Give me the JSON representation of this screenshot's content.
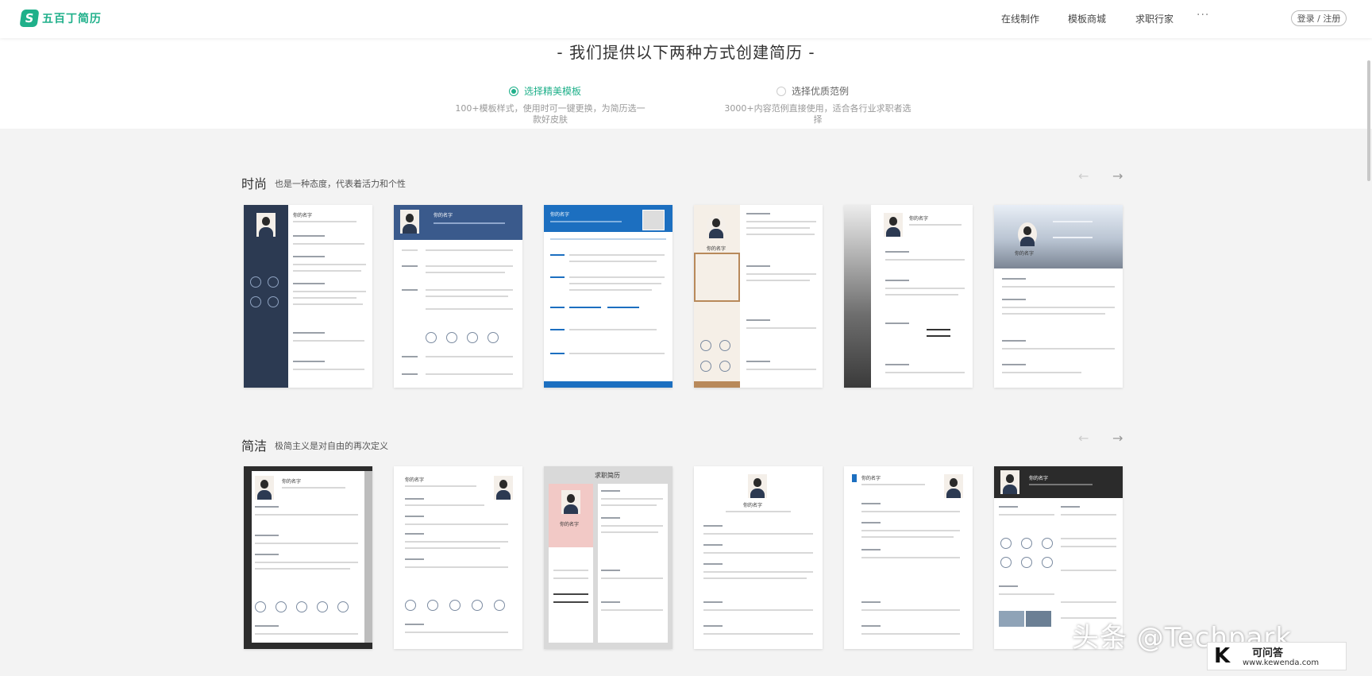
{
  "header": {
    "logo_text": "五百丁简历",
    "nav": [
      "在线制作",
      "模板商城",
      "求职行家"
    ],
    "more": "···",
    "login": "登录 / 注册"
  },
  "intro": {
    "title": "- 我们提供以下两种方式创建简历 -",
    "options": [
      {
        "label": "选择精美模板",
        "desc": "100+模板样式，使用时可一键更换，为简历选一款好皮肤",
        "selected": true
      },
      {
        "label": "选择优质范例",
        "desc": "3000+内容范例直接使用，适合各行业求职者选择",
        "selected": false
      }
    ]
  },
  "sections": [
    {
      "title": "时尚",
      "subtitle": "也是一种态度，代表着活力和个性",
      "arrow_prev": "←",
      "arrow_next": "→"
    },
    {
      "title": "简洁",
      "subtitle": "极简主义是对自由的再次定义",
      "arrow_prev": "←",
      "arrow_next": "→"
    }
  ],
  "template_texts": {
    "name": "你的名字",
    "resume_title": "求职简历"
  },
  "watermark": {
    "text": "头条 @Techpark",
    "badge_name": "可问答",
    "badge_url": "www.kewenda.com",
    "badge_letter": "K"
  },
  "colors": {
    "brand": "#1fb08a",
    "navy": "#2c3a52",
    "blue": "#3a5a8c",
    "bright_blue": "#1c6fc0"
  }
}
